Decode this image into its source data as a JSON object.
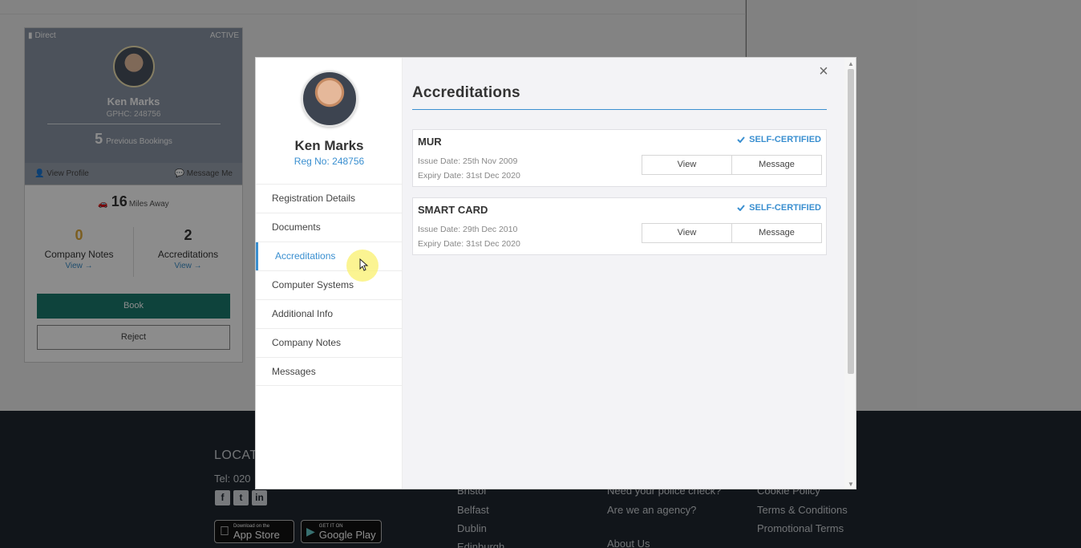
{
  "background_card": {
    "tag": "Direct",
    "status": "ACTIVE",
    "name": "Ken Marks",
    "gphc": "GPHC: 248756",
    "bookings_count": "5",
    "bookings_label": "Previous Bookings",
    "view_profile": "View Profile",
    "message_me": "Message Me",
    "distance_value": "16",
    "distance_label": "Miles Away",
    "company_notes_count": "0",
    "company_notes_label": "Company Notes",
    "accreditations_count": "2",
    "accreditations_label": "Accreditations",
    "view_link": "View →",
    "book_label": "Book",
    "reject_label": "Reject",
    "colors": {
      "book": "#1a7a6e",
      "notes_count": "#e0a93a"
    }
  },
  "footer": {
    "title": "LOCATE",
    "tel": "Tel: 020",
    "social_icons": [
      "facebook-icon",
      "twitter-icon",
      "linkedin-icon"
    ],
    "app_store": {
      "small": "Download on the",
      "big": "App Store"
    },
    "google_play": {
      "small": "GET IT ON",
      "big": "Google Play"
    },
    "col1": [
      "Bristol",
      "Belfast",
      "Dublin",
      "Edinburgh"
    ],
    "col2": [
      "Need your police check?",
      "Are we an agency?",
      "About Us"
    ],
    "col3": [
      "Cookie Policy",
      "Terms & Conditions",
      "Promotional Terms"
    ]
  },
  "modal": {
    "profile": {
      "name": "Ken Marks",
      "reg_no": "Reg No: 248756"
    },
    "nav": [
      {
        "label": "Registration Details",
        "active": false
      },
      {
        "label": "Documents",
        "active": false
      },
      {
        "label": "Accreditations",
        "active": true
      },
      {
        "label": "Computer Systems",
        "active": false
      },
      {
        "label": "Additional Info",
        "active": false
      },
      {
        "label": "Company Notes",
        "active": false
      },
      {
        "label": "Messages",
        "active": false
      }
    ],
    "title": "Accreditations",
    "close_icon": "×",
    "accreditations": [
      {
        "name": "MUR",
        "badge": "SELF-CERTIFIED",
        "issue": "Issue Date: 25th Nov 2009",
        "expiry": "Expiry Date: 31st Dec 2020",
        "view_label": "View",
        "message_label": "Message"
      },
      {
        "name": "SMART CARD",
        "badge": "SELF-CERTIFIED",
        "issue": "Issue Date: 29th Dec 2010",
        "expiry": "Expiry Date: 31st Dec 2020",
        "view_label": "View",
        "message_label": "Message"
      }
    ],
    "accent": "#3a8fd0"
  }
}
